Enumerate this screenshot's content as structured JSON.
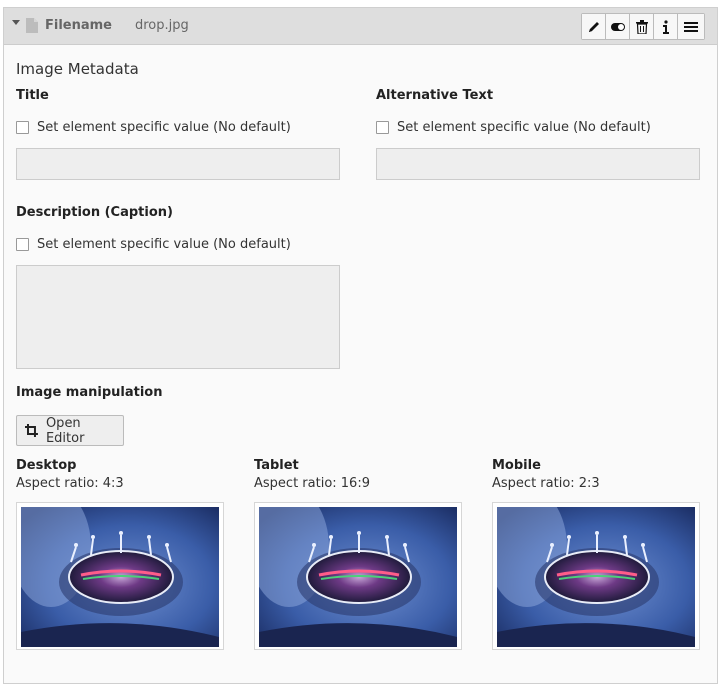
{
  "header": {
    "label": "Filename",
    "value": "drop.jpg",
    "actions": [
      {
        "name": "edit-icon",
        "label": "edit"
      },
      {
        "name": "toggle-icon",
        "label": "toggle"
      },
      {
        "name": "trash-icon",
        "label": "delete"
      },
      {
        "name": "info-icon",
        "label": "info"
      },
      {
        "name": "drag-handle-icon",
        "label": "menu"
      }
    ]
  },
  "section_title": "Image Metadata",
  "title_field": {
    "label": "Title",
    "checkbox_label": "Set element specific value (No default)",
    "value": ""
  },
  "alt_field": {
    "label": "Alternative Text",
    "checkbox_label": "Set element specific value (No default)",
    "value": ""
  },
  "description_field": {
    "label": "Description (Caption)",
    "checkbox_label": "Set element specific value (No default)",
    "value": ""
  },
  "manipulation": {
    "label": "Image manipulation",
    "open_editor": "Open Editor"
  },
  "variants": [
    {
      "title": "Desktop",
      "ratio": "Aspect ratio: 4:3"
    },
    {
      "title": "Tablet",
      "ratio": "Aspect ratio: 16:9"
    },
    {
      "title": "Mobile",
      "ratio": "Aspect ratio: 2:3"
    }
  ],
  "colors": {
    "header_bg": "#dedede",
    "panel_bg": "#fafafa",
    "field_bg": "#eeeeee"
  }
}
